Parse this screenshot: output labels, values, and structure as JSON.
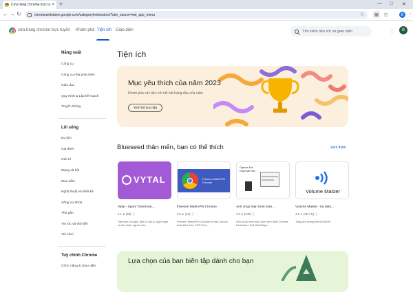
{
  "browser": {
    "tab_title": "Cửa hàng Chrome trực tuyến",
    "url": "chromewebstore.google.com/category/extensions?utm_source=ext_app_menu",
    "profile_initial": "B",
    "new_tab": "+",
    "tab_close": "×"
  },
  "header": {
    "store_name": "cửa hàng chrome trực tuyến",
    "nav": [
      "Khám phá",
      "Tiện ích",
      "Giao diện"
    ],
    "active_nav": "Tiện ích",
    "search_placeholder": "Tìm kiếm tiện ích và giao diện",
    "avatar_initial": "B"
  },
  "sidebar": {
    "sections": [
      {
        "title": "Năng suất",
        "items": [
          "Công cụ",
          "Công cụ nhà phát triển",
          "Giáo dục",
          "Quy trình & Lập kế hoạch",
          "Truyền thông"
        ]
      },
      {
        "title": "Lối sống",
        "items": [
          "Du lịch",
          "Gia đình",
          "Giải trí",
          "Mạng xã hội",
          "Mua sắm",
          "Nghệ thuật và thiết kế",
          "Sống vui khoẻ",
          "Thú gần",
          "Tin tức và thời tiết",
          "Trò chơi"
        ]
      },
      {
        "title": "Tuỳ chỉnh Chrome",
        "items": [
          "Chức năng & Giao diện"
        ]
      }
    ]
  },
  "main": {
    "title": "Tiện ích",
    "banner": {
      "title": "Mục yêu thích của năm 2023",
      "subtitle": "Khám phá các tiện ích nổi bật hàng đầu của năm",
      "button": "Xem bộ sưu tập"
    },
    "recommend": {
      "title": "Blueseed thân mến, bạn có thể thích",
      "see_more": "Xem thêm"
    },
    "cards": [
      {
        "name": "Vytal - Spoof Timezone,...",
        "rating": "4.1 ★ (88) ⓘ",
        "desc": "Giả mạo múi giờ, định vị địa lý, ngôn ngữ và tác nhân người dùn...",
        "thumb_text": "VYTAL"
      },
      {
        "name": "Freezen MateVPN Chrome",
        "rating": "3.0 ★ (42) ⓘ",
        "desc": "Freezen MateVPN Chrome is fast, secure, unlimited, free VPN Prox...",
        "thumb_text": "Freezen MateVPN Chrome"
      },
      {
        "name": "Ảnh chụp màn hình toàn...",
        "rating": "4.9 ★ (240) ⓘ",
        "desc": "Ảnh chụp màn hình toàn thời nhất Chrome Extension, Full WebPage...",
        "thumb_text": "Capture Ảnh chụp màn hình"
      },
      {
        "name": "Volume Master - bộ điều...",
        "rating": "4.8 ★ (36,7 N) ⓘ",
        "desc": "Tăng âm lượng lên tới 600%",
        "thumb_text": "Volume Master"
      }
    ],
    "editor": {
      "title": "Lựa chọn của ban biên tập dành cho bạn"
    }
  },
  "colors": {
    "accent": "#0b57d0",
    "banner_bg": "#fcefdd",
    "editor_bg": "#e6f4d7"
  }
}
